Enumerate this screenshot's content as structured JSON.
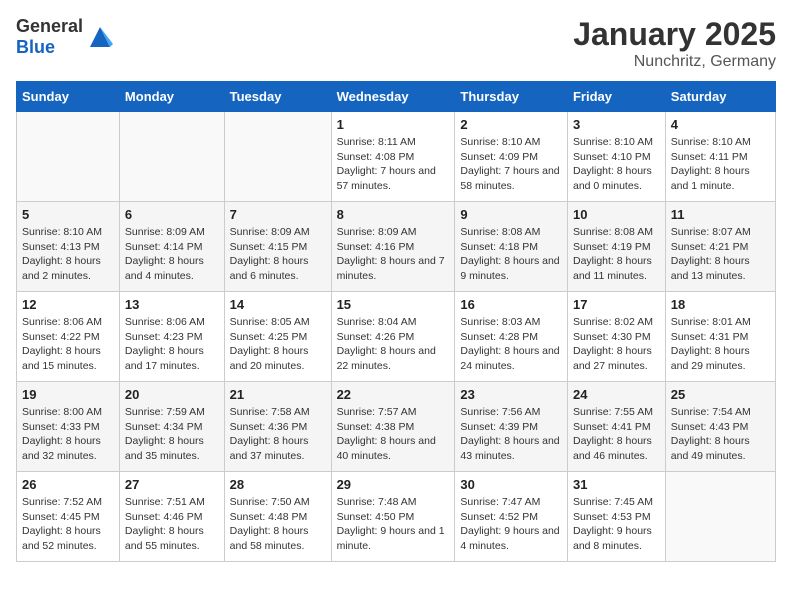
{
  "header": {
    "logo_general": "General",
    "logo_blue": "Blue",
    "month": "January 2025",
    "location": "Nunchritz, Germany"
  },
  "weekdays": [
    "Sunday",
    "Monday",
    "Tuesday",
    "Wednesday",
    "Thursday",
    "Friday",
    "Saturday"
  ],
  "weeks": [
    [
      {
        "day": "",
        "info": ""
      },
      {
        "day": "",
        "info": ""
      },
      {
        "day": "",
        "info": ""
      },
      {
        "day": "1",
        "info": "Sunrise: 8:11 AM\nSunset: 4:08 PM\nDaylight: 7 hours and 57 minutes."
      },
      {
        "day": "2",
        "info": "Sunrise: 8:10 AM\nSunset: 4:09 PM\nDaylight: 7 hours and 58 minutes."
      },
      {
        "day": "3",
        "info": "Sunrise: 8:10 AM\nSunset: 4:10 PM\nDaylight: 8 hours and 0 minutes."
      },
      {
        "day": "4",
        "info": "Sunrise: 8:10 AM\nSunset: 4:11 PM\nDaylight: 8 hours and 1 minute."
      }
    ],
    [
      {
        "day": "5",
        "info": "Sunrise: 8:10 AM\nSunset: 4:13 PM\nDaylight: 8 hours and 2 minutes."
      },
      {
        "day": "6",
        "info": "Sunrise: 8:09 AM\nSunset: 4:14 PM\nDaylight: 8 hours and 4 minutes."
      },
      {
        "day": "7",
        "info": "Sunrise: 8:09 AM\nSunset: 4:15 PM\nDaylight: 8 hours and 6 minutes."
      },
      {
        "day": "8",
        "info": "Sunrise: 8:09 AM\nSunset: 4:16 PM\nDaylight: 8 hours and 7 minutes."
      },
      {
        "day": "9",
        "info": "Sunrise: 8:08 AM\nSunset: 4:18 PM\nDaylight: 8 hours and 9 minutes."
      },
      {
        "day": "10",
        "info": "Sunrise: 8:08 AM\nSunset: 4:19 PM\nDaylight: 8 hours and 11 minutes."
      },
      {
        "day": "11",
        "info": "Sunrise: 8:07 AM\nSunset: 4:21 PM\nDaylight: 8 hours and 13 minutes."
      }
    ],
    [
      {
        "day": "12",
        "info": "Sunrise: 8:06 AM\nSunset: 4:22 PM\nDaylight: 8 hours and 15 minutes."
      },
      {
        "day": "13",
        "info": "Sunrise: 8:06 AM\nSunset: 4:23 PM\nDaylight: 8 hours and 17 minutes."
      },
      {
        "day": "14",
        "info": "Sunrise: 8:05 AM\nSunset: 4:25 PM\nDaylight: 8 hours and 20 minutes."
      },
      {
        "day": "15",
        "info": "Sunrise: 8:04 AM\nSunset: 4:26 PM\nDaylight: 8 hours and 22 minutes."
      },
      {
        "day": "16",
        "info": "Sunrise: 8:03 AM\nSunset: 4:28 PM\nDaylight: 8 hours and 24 minutes."
      },
      {
        "day": "17",
        "info": "Sunrise: 8:02 AM\nSunset: 4:30 PM\nDaylight: 8 hours and 27 minutes."
      },
      {
        "day": "18",
        "info": "Sunrise: 8:01 AM\nSunset: 4:31 PM\nDaylight: 8 hours and 29 minutes."
      }
    ],
    [
      {
        "day": "19",
        "info": "Sunrise: 8:00 AM\nSunset: 4:33 PM\nDaylight: 8 hours and 32 minutes."
      },
      {
        "day": "20",
        "info": "Sunrise: 7:59 AM\nSunset: 4:34 PM\nDaylight: 8 hours and 35 minutes."
      },
      {
        "day": "21",
        "info": "Sunrise: 7:58 AM\nSunset: 4:36 PM\nDaylight: 8 hours and 37 minutes."
      },
      {
        "day": "22",
        "info": "Sunrise: 7:57 AM\nSunset: 4:38 PM\nDaylight: 8 hours and 40 minutes."
      },
      {
        "day": "23",
        "info": "Sunrise: 7:56 AM\nSunset: 4:39 PM\nDaylight: 8 hours and 43 minutes."
      },
      {
        "day": "24",
        "info": "Sunrise: 7:55 AM\nSunset: 4:41 PM\nDaylight: 8 hours and 46 minutes."
      },
      {
        "day": "25",
        "info": "Sunrise: 7:54 AM\nSunset: 4:43 PM\nDaylight: 8 hours and 49 minutes."
      }
    ],
    [
      {
        "day": "26",
        "info": "Sunrise: 7:52 AM\nSunset: 4:45 PM\nDaylight: 8 hours and 52 minutes."
      },
      {
        "day": "27",
        "info": "Sunrise: 7:51 AM\nSunset: 4:46 PM\nDaylight: 8 hours and 55 minutes."
      },
      {
        "day": "28",
        "info": "Sunrise: 7:50 AM\nSunset: 4:48 PM\nDaylight: 8 hours and 58 minutes."
      },
      {
        "day": "29",
        "info": "Sunrise: 7:48 AM\nSunset: 4:50 PM\nDaylight: 9 hours and 1 minute."
      },
      {
        "day": "30",
        "info": "Sunrise: 7:47 AM\nSunset: 4:52 PM\nDaylight: 9 hours and 4 minutes."
      },
      {
        "day": "31",
        "info": "Sunrise: 7:45 AM\nSunset: 4:53 PM\nDaylight: 9 hours and 8 minutes."
      },
      {
        "day": "",
        "info": ""
      }
    ]
  ]
}
